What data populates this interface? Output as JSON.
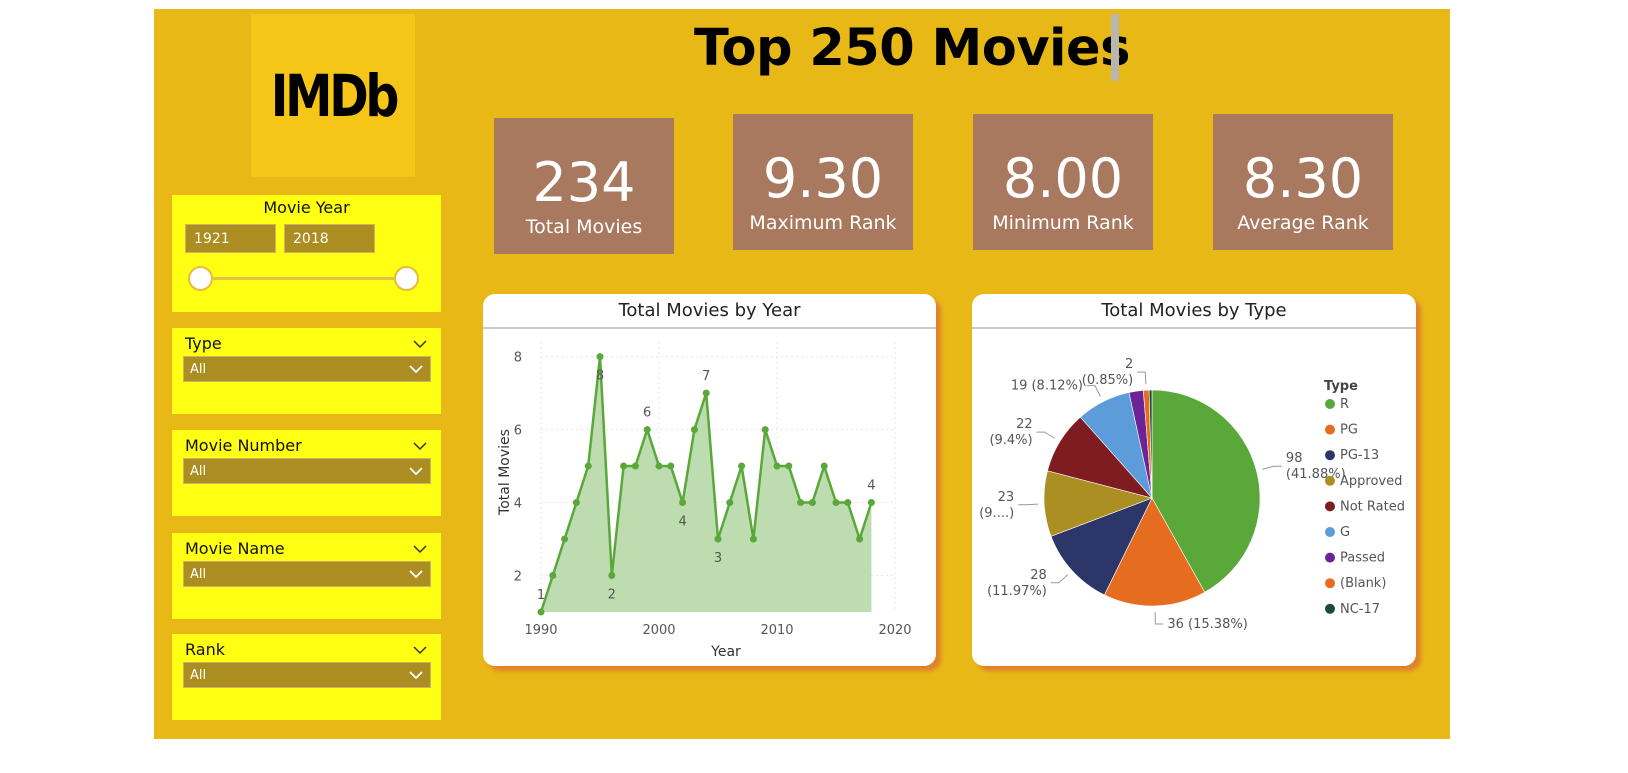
{
  "header": {
    "logo": "IMDb",
    "title": "Top 250 Movies"
  },
  "kpis": [
    {
      "value": "234",
      "label": "Total Movies"
    },
    {
      "value": "9.30",
      "label": "Maximum Rank"
    },
    {
      "value": "8.00",
      "label": "Minimum Rank"
    },
    {
      "value": "8.30",
      "label": "Average Rank"
    }
  ],
  "filters": {
    "year": {
      "title": "Movie Year",
      "from": "1921",
      "to": "2018"
    },
    "type": {
      "title": "Type",
      "value": "All"
    },
    "movie_number": {
      "title": "Movie Number",
      "value": "All"
    },
    "movie_name": {
      "title": "Movie Name",
      "value": "All"
    },
    "rank": {
      "title": "Rank",
      "value": "All"
    }
  },
  "colors": {
    "canvas": "#e8b816",
    "logo": "#f5c518",
    "kpi": "#a8785f",
    "slicer": "#ffff13",
    "line": "#5aa83a",
    "area": "#bddcb0"
  },
  "chart_data": [
    {
      "type": "area",
      "title": "Total Movies by Year",
      "xlabel": "Year",
      "ylabel": "Total Movies",
      "xlim": [
        1990,
        2020
      ],
      "ylim": [
        1,
        8.4
      ],
      "xticks": [
        1990,
        2000,
        2010,
        2020
      ],
      "yticks": [
        2,
        4,
        6,
        8
      ],
      "x": [
        1990,
        1991,
        1992,
        1993,
        1994,
        1995,
        1996,
        1997,
        1998,
        1999,
        2000,
        2001,
        2002,
        2003,
        2004,
        2005,
        2006,
        2007,
        2008,
        2009,
        2010,
        2011,
        2012,
        2013,
        2014,
        2015,
        2016,
        2017,
        2018
      ],
      "values": [
        1,
        2,
        3,
        4,
        5,
        8,
        2,
        5,
        5,
        6,
        5,
        5,
        4,
        6,
        7,
        3,
        4,
        5,
        3,
        6,
        5,
        5,
        4,
        4,
        5,
        4,
        4,
        3,
        4
      ],
      "data_labels": [
        {
          "x": 1990,
          "text": "1",
          "pos": "above"
        },
        {
          "x": 1995,
          "text": "8",
          "pos": "below"
        },
        {
          "x": 1996,
          "text": "2",
          "pos": "below"
        },
        {
          "x": 1999,
          "text": "6",
          "pos": "above"
        },
        {
          "x": 2002,
          "text": "4",
          "pos": "below"
        },
        {
          "x": 2004,
          "text": "7",
          "pos": "above"
        },
        {
          "x": 2005,
          "text": "3",
          "pos": "below"
        },
        {
          "x": 2018,
          "text": "4",
          "pos": "above"
        }
      ],
      "grid": true
    },
    {
      "type": "pie",
      "title": "Total Movies by Type",
      "legend_title": "Type",
      "legend_position": "right",
      "slices": [
        {
          "name": "R",
          "value": 98,
          "label": [
            "98",
            "(41.88%)"
          ],
          "color": "#5aa83a"
        },
        {
          "name": "PG",
          "value": 36,
          "label": [
            "36 (15.38%)"
          ],
          "color": "#e66c20"
        },
        {
          "name": "PG-13",
          "value": 28,
          "label": [
            "28",
            "(11.97%)"
          ],
          "color": "#2d3669"
        },
        {
          "name": "Approved",
          "value": 23,
          "label": [
            "23",
            "(9....)"
          ],
          "color": "#ac8f22"
        },
        {
          "name": "Not Rated",
          "value": 22,
          "label": [
            "22",
            "(9.4%)"
          ],
          "color": "#7e1c22"
        },
        {
          "name": "G",
          "value": 19,
          "label": [
            "19 (8.12%)"
          ],
          "color": "#5d9cda"
        },
        {
          "name": "Passed",
          "value": 5,
          "label": [],
          "color": "#6c2395"
        },
        {
          "name": "(Blank)",
          "value": 2,
          "label": [
            "2",
            "(0.85%)"
          ],
          "color": "#e66c20"
        },
        {
          "name": "NC-17",
          "value": 1,
          "label": [],
          "color": "#1d4d38"
        }
      ]
    }
  ]
}
